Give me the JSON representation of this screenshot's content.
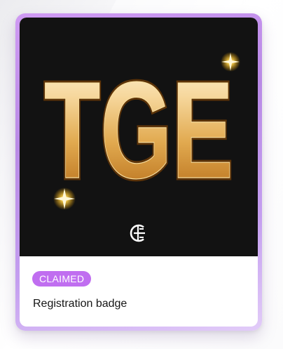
{
  "card": {
    "artwork_text": "TGE",
    "logo_icon": "cg-monogram-icon",
    "status_label": "CLAIMED",
    "title": "Registration badge"
  },
  "colors": {
    "frame_gradient_start": "#cf9af3",
    "frame_gradient_end": "#e2ccf8",
    "artwork_background": "#121212",
    "gold_light": "#fff0c8",
    "gold_mid": "#e5b15a",
    "gold_dark": "#a8661a",
    "status_badge": "#c06ef0"
  }
}
